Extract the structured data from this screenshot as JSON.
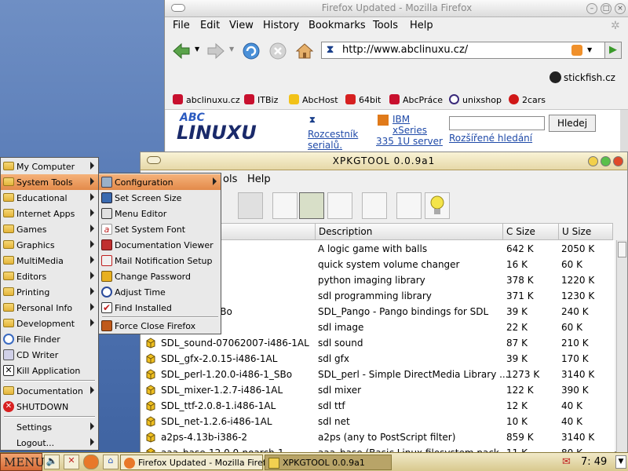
{
  "firefox": {
    "title": "Firefox Updated - Mozilla Firefox",
    "menus": [
      "File",
      "Edit",
      "View",
      "History",
      "Bookmarks",
      "Tools",
      "Help"
    ],
    "url": "http://www.abclinuxu.cz/",
    "stickfish": "stickfish.cz",
    "bookmarks": [
      "abclinuxu.cz",
      "ITBiz",
      "AbcHost",
      "64bit",
      "AbcPráce",
      "unixshop",
      "2cars"
    ],
    "page": {
      "logo_top": "ABC",
      "logo_main": "LINUXU",
      "link1a": "Rozcestník",
      "link1b": "serialů.",
      "ibm1": "IBM",
      "ibm2": "xSeries",
      "ibm3": "335 1U server",
      "search_btn": "Hledej",
      "adv_search": "Rozšířené hledání"
    }
  },
  "xpkgtool": {
    "title": "XPKGTOOL 0.0.9a1",
    "menus": [
      "ols",
      "Help"
    ],
    "columns": [
      "Description",
      "C Size",
      "U Size"
    ],
    "rows": [
      {
        "name": "6-1AS",
        "desc": "A logic game with balls",
        "c": "642 K",
        "u": "2050 K"
      },
      {
        "name": "1-i486-1AS",
        "desc": "quick system volume changer",
        "c": "16 K",
        "u": "60 K"
      },
      {
        "name": "-1AL",
        "desc": "python imaging library",
        "c": "378 K",
        "u": "1220 K"
      },
      {
        "name": "86-1AL",
        "desc": "sdl programming library",
        "c": "371 K",
        "u": "1230 K"
      },
      {
        "name": "1.2-i486-1_SBo",
        "desc": "SDL_Pango - Pango bindings for SDL",
        "c": "39 K",
        "u": "240 K"
      },
      {
        "name": "2.5-i486-1AL",
        "desc": "sdl image",
        "c": "22 K",
        "u": "60 K"
      },
      {
        "name": "SDL_sound-07062007-i486-1AL",
        "desc": "sdl sound",
        "c": "87 K",
        "u": "210 K"
      },
      {
        "name": "SDL_gfx-2.0.15-i486-1AL",
        "desc": "sdl gfx",
        "c": "39 K",
        "u": "170 K"
      },
      {
        "name": "SDL_perl-1.20.0-i486-1_SBo",
        "desc": "SDL_perl - Simple DirectMedia Library ...",
        "c": "1273 K",
        "u": "3140 K"
      },
      {
        "name": "SDL_mixer-1.2.7-i486-1AL",
        "desc": "sdl mixer",
        "c": "122 K",
        "u": "390 K"
      },
      {
        "name": "SDL_ttf-2.0.8-1.i486-1AL",
        "desc": "sdl ttf",
        "c": "12 K",
        "u": "40 K"
      },
      {
        "name": "SDL_net-1.2.6-i486-1AL",
        "desc": "sdl net",
        "c": "10 K",
        "u": "40 K"
      },
      {
        "name": "a2ps-4.13b-i386-2",
        "desc": "a2ps (any to PostScript filter)",
        "c": "859 K",
        "u": "3140 K"
      },
      {
        "name": "aaa_base-12.0.0-noarch-1",
        "desc": "aaa_base (Basic Linux filesystem pack...",
        "c": "11 K",
        "u": "80 K"
      }
    ]
  },
  "startmenu": {
    "items": [
      "My Computer",
      "System Tools",
      "Educational",
      "Internet Apps",
      "Games",
      "Graphics",
      "MultiMedia",
      "Editors",
      "Printing",
      "Personal Info",
      "Development",
      "File Finder",
      "CD Writer",
      "Kill Application",
      "Documentation",
      "SHUTDOWN",
      "Settings",
      "Logout..."
    ]
  },
  "submenu": {
    "items": [
      "Configuration",
      "Set Screen Size",
      "Menu Editor",
      "Set System Font",
      "Documentation Viewer",
      "Mail Notification Setup",
      "Change Password",
      "Adjust Time",
      "Find Installed",
      "Force Close Firefox"
    ]
  },
  "taskbar": {
    "menu": "MENU",
    "tasks": [
      "Firefox Updated - Mozilla Firefox",
      "XPKGTOOL 0.0.9a1"
    ],
    "clock": "7: 49"
  }
}
